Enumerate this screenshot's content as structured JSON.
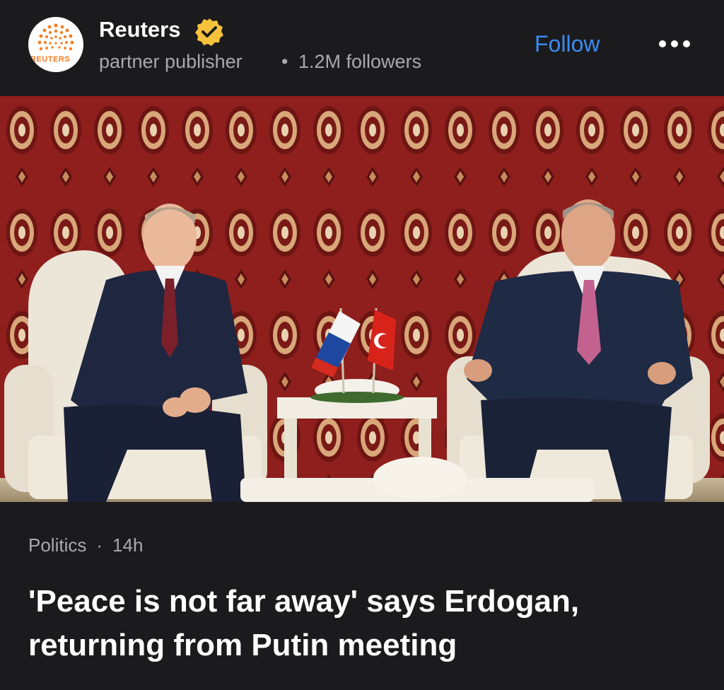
{
  "publisher": {
    "name": "Reuters",
    "logo_text": "REUTERS",
    "type": "partner publisher",
    "separator": "•",
    "followers": "1.2M followers",
    "verified_icon": "verified-badge-icon",
    "follow_label": "Follow",
    "more_icon": "more-options-icon"
  },
  "photo": {
    "subject": "news-photo"
  },
  "article": {
    "category": "Politics",
    "separator": "·",
    "age": "14h",
    "headline": "'Peace is not far away' says Erdogan, returning from Putin meeting"
  },
  "colors": {
    "background": "#1b1b1d",
    "accent": "#3b8bf2",
    "muted_text": "#a9a9ad",
    "badge": "#f6c23a",
    "reuters_orange": "#f47c20"
  }
}
